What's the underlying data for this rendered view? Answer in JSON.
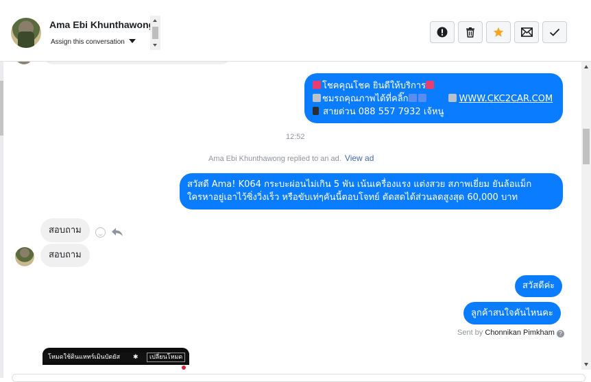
{
  "header": {
    "contact_name": "Ama Ebi Khunthawong",
    "assign_label": "Assign this conversation",
    "actions": [
      {
        "name": "spam-button",
        "icon": "alert-circle-icon"
      },
      {
        "name": "delete-button",
        "icon": "trash-icon"
      },
      {
        "name": "star-button",
        "icon": "star-icon"
      },
      {
        "name": "unread-button",
        "icon": "envelope-icon"
      },
      {
        "name": "done-button",
        "icon": "checkmark-icon"
      }
    ]
  },
  "messages": {
    "promo": {
      "line1": "โชคคุณโชค ยินดีให้บริการ",
      "line2": "ชมรถคุณภาพได้ที่คลิ๊ก",
      "link": "WWW.CKC2CAR.COM",
      "line3": "สายด่วน 088 557 7932 เจ้หนู"
    },
    "timestamp": "12:52",
    "ad_note": "Ama Ebi Khunthawong replied to an ad.",
    "view_ad": "View ad",
    "greeting_line1": "สวัสดี Ama! K064 กระบะผ่อนไม่เกิน 5 พัน เน้นเครื่องแรง แต่งสวย สภาพเยี่ยม ยันล้อแม็ก",
    "greeting_line2": "ใครหาอยู่เอาไว้ซิ่งวิ่งเร็ว หรือขับเท่ๆคันนี้ตอบโจทย์ ตัดสดได้ส่วนลดสูงสุด 60,000 บาท",
    "inquiry_1": "สอบถาม",
    "inquiry_2": "สอบถาม",
    "reply_hello": "สวัสดีค่ะ",
    "reply_question": "ลูกค้าสนใจคันไหนคะ",
    "sent_by_prefix": "Sent by",
    "sent_by_name": "Chonnikan Pimkham",
    "image_caption": "โหมดใช้ดินแหทร์เมินบัตยัส",
    "image_button": "เปลี่ยนโหมด"
  },
  "colors": {
    "outgoing_bubble": "#0a7cff",
    "incoming_bubble": "#f1f0f0",
    "star": "#f5a623",
    "link": "#4267b2"
  }
}
